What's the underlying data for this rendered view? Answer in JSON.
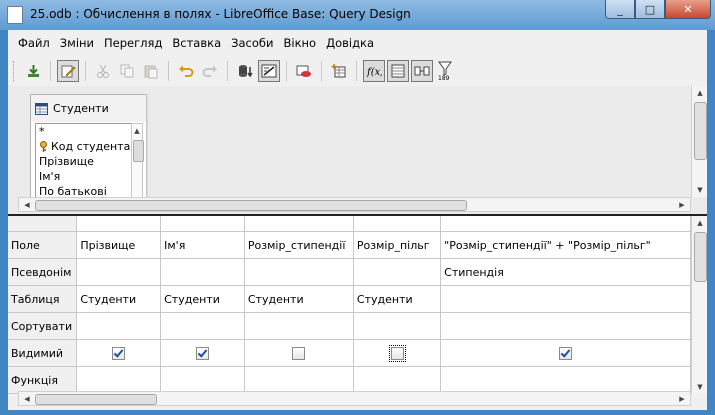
{
  "window": {
    "title": "25.odb : Обчислення в полях - LibreOffice Base: Query Design",
    "minimize_glyph": "_",
    "maximize_glyph": "□",
    "close_glyph": "✕"
  },
  "menu": [
    "Файл",
    "Зміни",
    "Перегляд",
    "Вставка",
    "Засоби",
    "Вікно",
    "Довідка"
  ],
  "toolbar": {
    "icons": [
      "save-icon",
      "edit-mode-icon",
      "cut-icon",
      "copy-icon",
      "paste-icon",
      "undo-icon",
      "redo-icon",
      "run-query-icon",
      "design-view-icon",
      "clear-query-icon",
      "add-table-icon",
      "functions-icon",
      "table-name-icon",
      "alias-icon",
      "distinct-values-icon"
    ],
    "functions_label": "f(x)",
    "distinct_label": "189"
  },
  "table_window": {
    "title": "Студенти",
    "fields": [
      {
        "name": "*",
        "key": false
      },
      {
        "name": "Код студента",
        "key": true
      },
      {
        "name": "Прізвище",
        "key": false
      },
      {
        "name": "Ім'я",
        "key": false
      },
      {
        "name": "По батькові",
        "key": false
      }
    ]
  },
  "grid": {
    "row_headers": [
      "Поле",
      "Псевдонім",
      "Таблиця",
      "Сортувати",
      "Видимий",
      "Функція"
    ],
    "columns": [
      {
        "field": "Прізвище",
        "alias": "",
        "table": "Студенти",
        "sort": "",
        "visible": true,
        "focus": false
      },
      {
        "field": "Ім'я",
        "alias": "",
        "table": "Студенти",
        "sort": "",
        "visible": true,
        "focus": false
      },
      {
        "field": "Розмір_стипендії",
        "alias": "",
        "table": "Студенти",
        "sort": "",
        "visible": false,
        "focus": false
      },
      {
        "field": "Розмір_пільг",
        "alias": "",
        "table": "Студенти",
        "sort": "",
        "visible": false,
        "focus": true
      },
      {
        "field": "\"Розмір_стипендії\" + \"Розмір_пільг\"",
        "alias": "Стипендія",
        "table": "",
        "sort": "",
        "visible": true,
        "focus": false
      }
    ]
  }
}
